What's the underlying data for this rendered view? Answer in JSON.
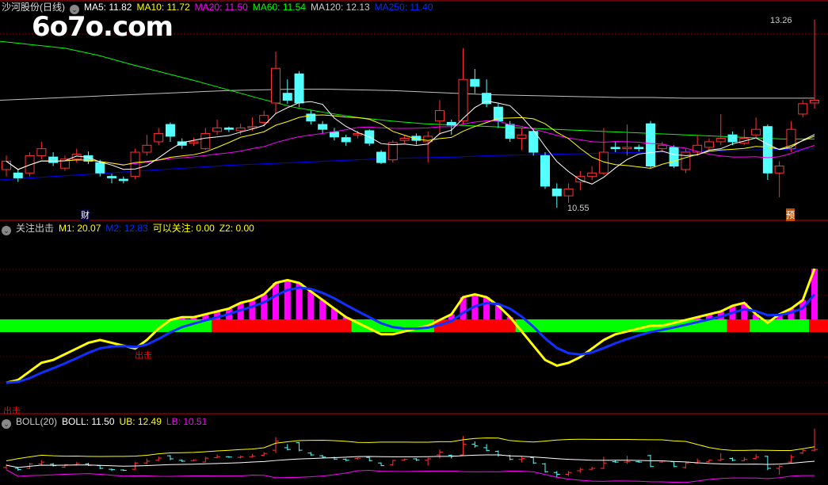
{
  "main_header": {
    "title": "沙河股份(日线)",
    "ma5": "MA5: 11.82",
    "ma10": "MA10: 11.72",
    "ma20": "MA20: 11.50",
    "ma60": "MA60: 11.54",
    "ma120": "MA120: 12.13",
    "ma250": "MA250: 11.40"
  },
  "watermark": "6o7o.com",
  "ind_header": {
    "title": "关注出击",
    "m1": "M1: 20.07",
    "m2": "M2: 12.83",
    "kyg": "可以关注: 0.00",
    "z2": "Z2: 0.00"
  },
  "boll_header": {
    "title": "BOLL(20)",
    "boll": "BOLL: 11.50",
    "ub": "UB: 12.49",
    "lb": "LB: 10.51"
  },
  "annotations": {
    "high": "13.26",
    "low": "10.55",
    "cai": "财",
    "yu": "预",
    "chuji": "出击"
  },
  "colors": {
    "up": "#ff3232",
    "down": "#54ffff",
    "ma5": "#ffffff",
    "ma10": "#ffff00",
    "ma20": "#ff00ff",
    "ma60": "#00ff00",
    "ma120": "#c0c0c0",
    "ma250": "#0000ff",
    "bar": "#ff00ff",
    "band_green": "#00ff00",
    "band_red": "#ff0000"
  },
  "chart_data": {
    "type": "candlestick",
    "price_range": [
      10.55,
      13.26
    ],
    "candles": [
      [
        11.1,
        11.22,
        11.3,
        11.0
      ],
      [
        11.05,
        10.98,
        11.1,
        10.92
      ],
      [
        11.05,
        11.3,
        11.35,
        11.0
      ],
      [
        11.3,
        11.4,
        11.5,
        11.25
      ],
      [
        11.28,
        11.2,
        11.35,
        11.15
      ],
      [
        11.12,
        11.25,
        11.3,
        11.08
      ],
      [
        11.25,
        11.32,
        11.4,
        11.2
      ],
      [
        11.3,
        11.22,
        11.36,
        11.18
      ],
      [
        11.2,
        11.05,
        11.24,
        11.0
      ],
      [
        11.0,
        10.98,
        11.04,
        10.9
      ],
      [
        10.96,
        10.94,
        11.0,
        10.9
      ],
      [
        11.0,
        11.35,
        11.4,
        10.96
      ],
      [
        11.35,
        11.45,
        11.6,
        11.3
      ],
      [
        11.5,
        11.62,
        11.7,
        11.45
      ],
      [
        11.75,
        11.58,
        11.78,
        11.5
      ],
      [
        11.5,
        11.45,
        11.55,
        11.4
      ],
      [
        11.48,
        11.5,
        11.56,
        11.44
      ],
      [
        11.4,
        11.62,
        11.7,
        11.38
      ],
      [
        11.65,
        11.7,
        11.82,
        11.6
      ],
      [
        11.7,
        11.68,
        11.72,
        11.64
      ],
      [
        11.66,
        11.7,
        11.76,
        11.6
      ],
      [
        11.7,
        11.72,
        11.85,
        11.66
      ],
      [
        11.78,
        11.88,
        11.95,
        11.72
      ],
      [
        12.06,
        12.56,
        12.8,
        11.9
      ],
      [
        12.2,
        12.1,
        12.4,
        12.05
      ],
      [
        12.48,
        12.06,
        12.52,
        12.0
      ],
      [
        11.9,
        11.8,
        11.95,
        11.75
      ],
      [
        11.75,
        11.68,
        11.8,
        11.62
      ],
      [
        11.64,
        11.57,
        11.7,
        11.52
      ],
      [
        11.56,
        11.5,
        11.6,
        11.44
      ],
      [
        11.6,
        11.62,
        11.66,
        11.55
      ],
      [
        11.66,
        11.48,
        11.68,
        11.44
      ],
      [
        11.35,
        11.2,
        11.38,
        11.18
      ],
      [
        11.24,
        11.49,
        11.52,
        11.2
      ],
      [
        11.52,
        11.55,
        11.6,
        11.48
      ],
      [
        11.58,
        11.52,
        11.62,
        11.46
      ],
      [
        11.5,
        11.58,
        11.65,
        11.2
      ],
      [
        11.8,
        11.95,
        12.1,
        11.6
      ],
      [
        11.78,
        11.74,
        11.82,
        11.6
      ],
      [
        11.8,
        12.4,
        12.85,
        11.75
      ],
      [
        12.4,
        12.3,
        12.55,
        12.2
      ],
      [
        12.2,
        12.05,
        12.4,
        12.0
      ],
      [
        12.0,
        11.8,
        12.05,
        11.7
      ],
      [
        11.75,
        11.55,
        11.8,
        11.5
      ],
      [
        11.55,
        11.6,
        11.7,
        11.38
      ],
      [
        11.65,
        11.35,
        11.68,
        11.3
      ],
      [
        11.3,
        10.86,
        11.35,
        10.82
      ],
      [
        10.82,
        10.72,
        10.9,
        10.55
      ],
      [
        10.72,
        10.82,
        10.9,
        10.62
      ],
      [
        10.92,
        11.0,
        11.08,
        10.8
      ],
      [
        11.0,
        11.05,
        11.15,
        10.95
      ],
      [
        11.05,
        11.35,
        11.7,
        11.02
      ],
      [
        11.42,
        11.4,
        11.5,
        11.35
      ],
      [
        11.4,
        11.42,
        11.75,
        11.3
      ],
      [
        11.42,
        11.4,
        11.46,
        11.36
      ],
      [
        11.76,
        11.15,
        11.8,
        11.12
      ],
      [
        11.4,
        11.45,
        11.5,
        11.35
      ],
      [
        11.42,
        11.15,
        11.45,
        11.12
      ],
      [
        11.1,
        11.35,
        11.4,
        11.05
      ],
      [
        11.35,
        11.45,
        11.6,
        11.3
      ],
      [
        11.42,
        11.5,
        11.55,
        11.38
      ],
      [
        11.5,
        11.55,
        11.9,
        11.45
      ],
      [
        11.6,
        11.5,
        11.65,
        11.45
      ],
      [
        11.48,
        11.55,
        11.68,
        11.45
      ],
      [
        11.6,
        11.68,
        11.85,
        11.55
      ],
      [
        11.72,
        11.05,
        11.75,
        10.95
      ],
      [
        11.05,
        11.15,
        11.22,
        10.7
      ],
      [
        11.4,
        11.68,
        11.8,
        11.35
      ],
      [
        11.9,
        12.05,
        12.1,
        11.85
      ],
      [
        12.06,
        12.1,
        13.26,
        11.98
      ]
    ],
    "ma60": [
      12.95,
      12.9,
      12.85,
      12.75,
      12.62,
      12.5,
      12.38,
      12.25,
      12.12,
      12.0,
      11.92,
      11.85,
      11.8,
      11.76,
      11.74,
      11.72,
      11.7,
      11.68,
      11.66,
      11.64,
      11.62,
      11.6,
      11.58,
      11.56,
      11.54,
      11.54
    ],
    "ma120": [
      12.1,
      12.12,
      12.14,
      12.16,
      12.18,
      12.2,
      12.22,
      12.24,
      12.25,
      12.26,
      12.26,
      12.25,
      12.24,
      12.22,
      12.2,
      12.18,
      12.17,
      12.16,
      12.15,
      12.14,
      12.14,
      12.13,
      12.13,
      12.13,
      12.13,
      12.13
    ],
    "ma250": [
      10.95,
      10.98,
      11.01,
      11.04,
      11.07,
      11.1,
      11.13,
      11.16,
      11.18,
      11.2,
      11.22,
      11.24,
      11.26,
      11.27,
      11.28,
      11.3,
      11.31,
      11.32,
      11.33,
      11.34,
      11.35,
      11.36,
      11.37,
      11.38,
      11.39,
      11.4
    ],
    "m1": [
      -20,
      -19,
      -16,
      -13,
      -12,
      -10,
      -8,
      -6,
      -5,
      -6,
      -7,
      -8,
      -5,
      -1,
      2,
      3,
      3,
      4,
      5,
      6,
      8,
      9,
      11,
      15,
      16,
      15,
      12,
      9,
      6,
      3,
      1,
      -1,
      -3,
      -3,
      -2,
      -1,
      0,
      2,
      4,
      10,
      11,
      10,
      7,
      3,
      -2,
      -7,
      -12,
      -14,
      -13,
      -11,
      -8,
      -5,
      -3,
      -2,
      -1,
      0,
      0,
      1,
      2,
      3,
      4,
      5,
      7,
      8,
      4,
      1,
      4,
      6,
      9,
      20
    ],
    "red_ranges": [
      [
        19,
        30
      ],
      [
        38,
        44
      ],
      [
        63,
        64
      ],
      [
        70,
        70
      ]
    ]
  }
}
